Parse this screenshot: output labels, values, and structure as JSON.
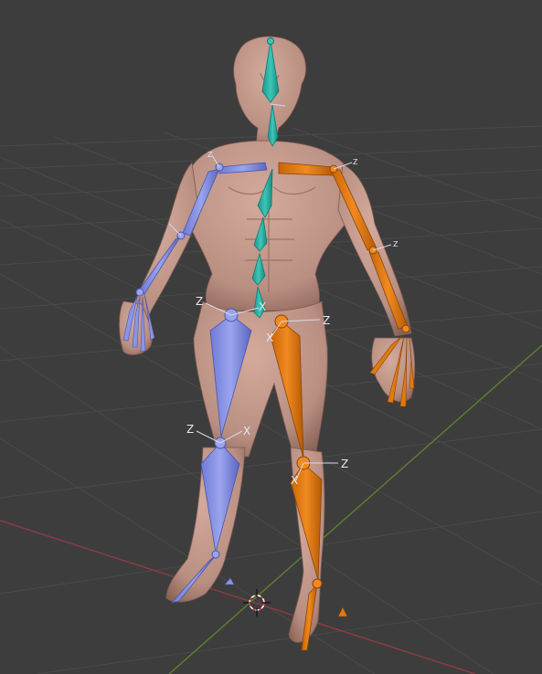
{
  "app": "3d-viewport",
  "colors": {
    "background": "#3d3d3d",
    "grid": "#4b4b4b",
    "x_axis": "#8a3b46",
    "y_axis": "#5c7d2f",
    "skin": "#c49a8c",
    "skin_shadow": "#8e6a5f",
    "bone_left": "#7f8be0",
    "bone_right": "#e07a12",
    "bone_spine": "#2fb2a6",
    "cursor": "#e04040"
  },
  "icons": {
    "cursor": "3d-cursor-icon"
  },
  "axis_labels": {
    "z": "Z",
    "x": "X"
  }
}
